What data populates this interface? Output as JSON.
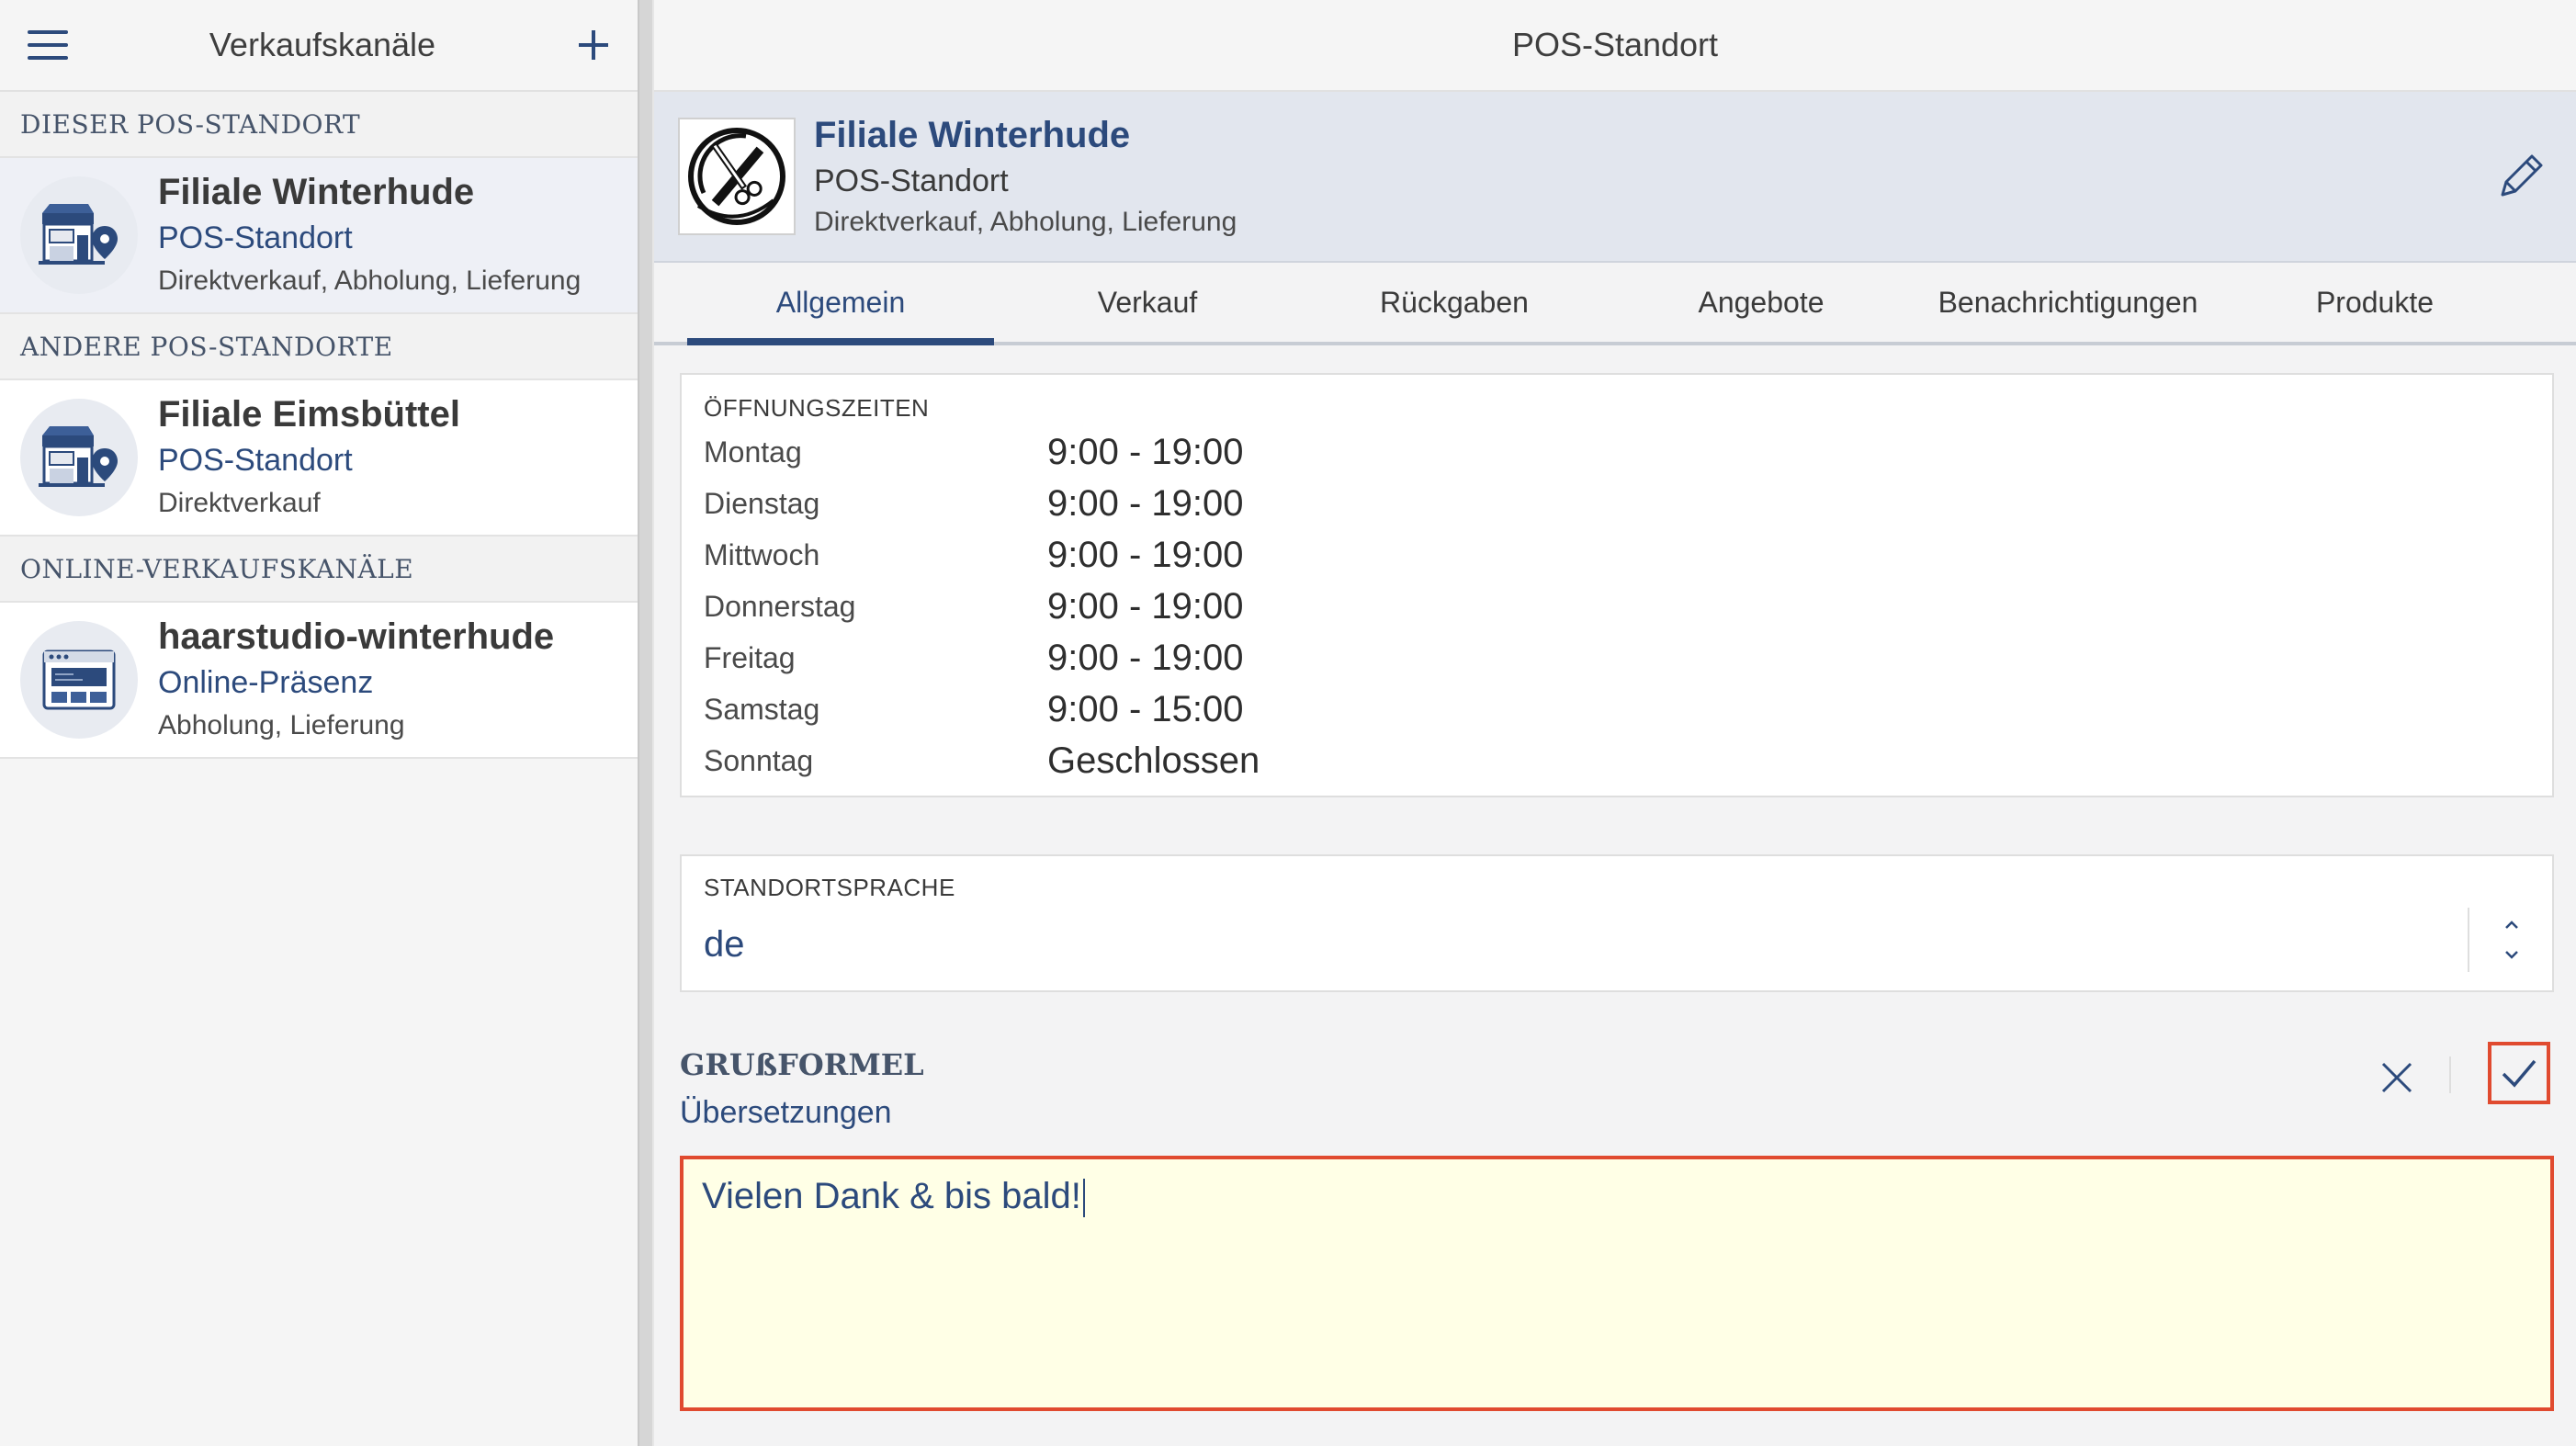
{
  "sidebar": {
    "title": "Verkaufskanäle",
    "sections": [
      {
        "header": "DIESER POS-STANDORT",
        "items": [
          {
            "name": "Filiale Winterhude",
            "type": "POS-Standort",
            "desc": "Direktverkauf, Abholung, Lieferung",
            "icon": "store-location-icon"
          }
        ]
      },
      {
        "header": "ANDERE POS-STANDORTE",
        "items": [
          {
            "name": "Filiale Eimsbüttel",
            "type": "POS-Standort",
            "desc": "Direktverkauf",
            "icon": "store-location-icon"
          }
        ]
      },
      {
        "header": "ONLINE-VERKAUFSKANÄLE",
        "items": [
          {
            "name": "haarstudio-winterhude",
            "type": "Online-Präsenz",
            "desc": "Abholung, Lieferung",
            "icon": "browser-window-icon"
          }
        ]
      }
    ]
  },
  "main": {
    "title": "POS-Standort",
    "location": {
      "name": "Filiale Winterhude",
      "type": "POS-Standort",
      "desc": "Direktverkauf, Abholung, Lieferung"
    },
    "tabs": [
      "Allgemein",
      "Verkauf",
      "Rückgaben",
      "Angebote",
      "Benachrichtigungen",
      "Produkte"
    ],
    "active_tab": "Allgemein",
    "opening_hours": {
      "label": "ÖFFNUNGSZEITEN",
      "rows": [
        {
          "day": "Montag",
          "time": "9:00 - 19:00"
        },
        {
          "day": "Dienstag",
          "time": "9:00 - 19:00"
        },
        {
          "day": "Mittwoch",
          "time": "9:00 - 19:00"
        },
        {
          "day": "Donnerstag",
          "time": "9:00 - 19:00"
        },
        {
          "day": "Freitag",
          "time": "9:00 - 19:00"
        },
        {
          "day": "Samstag",
          "time": "9:00 - 15:00"
        },
        {
          "day": "Sonntag",
          "time": "Geschlossen"
        }
      ]
    },
    "language": {
      "label": "STANDORTSPRACHE",
      "value": "de"
    },
    "greeting": {
      "label": "GRUßFORMEL",
      "translations_link": "Übersetzungen",
      "value": "Vielen Dank & bis bald!"
    }
  },
  "colors": {
    "accent": "#2c4a7c",
    "highlight_border": "#e04a2f",
    "textarea_bg": "#ffffe6"
  }
}
